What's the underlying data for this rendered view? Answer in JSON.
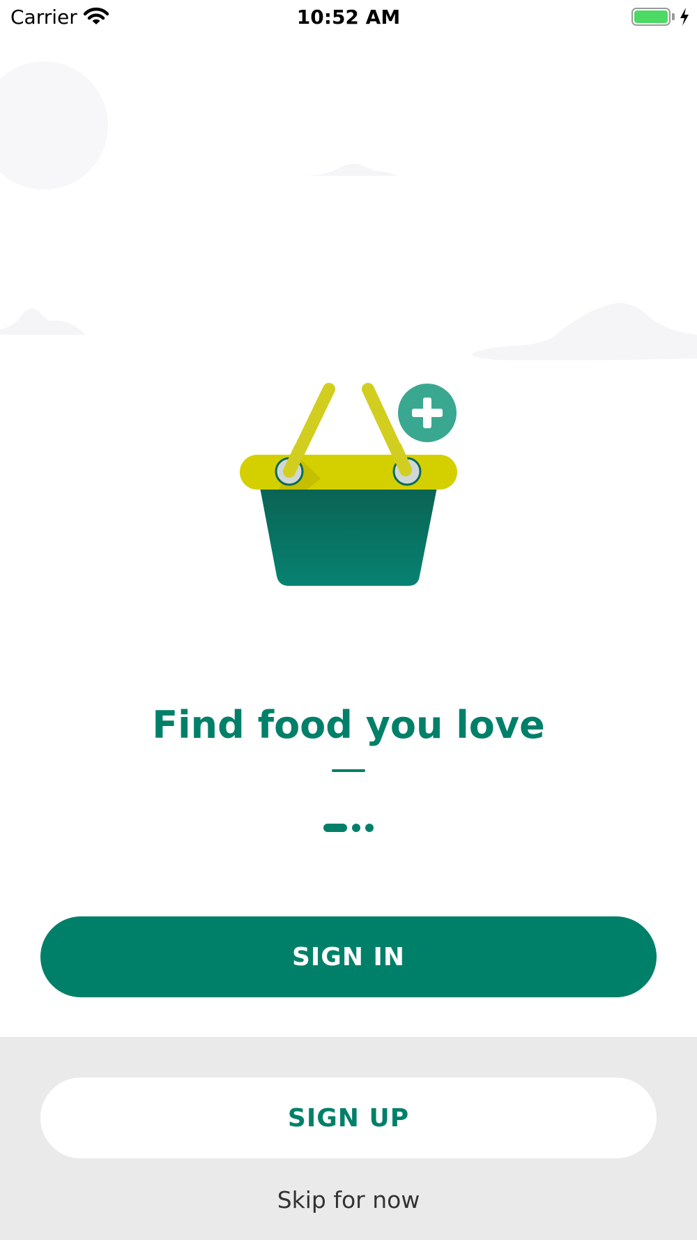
{
  "status_bar": {
    "carrier": "Carrier",
    "time": "10:52 AM",
    "battery_level": 1.0
  },
  "onboarding": {
    "title": "Find food you love",
    "page_count": 3,
    "current_page": 1
  },
  "actions": {
    "sign_in_label": "SIGN IN",
    "sign_up_label": "SIGN UP",
    "skip_label": "Skip for now"
  },
  "colors": {
    "primary": "#008069",
    "basket_rim": "#d4d000",
    "basket_body": "#086b5a",
    "plus_badge": "#3aa890",
    "bottom_panel": "#eaeaea"
  },
  "icons": [
    "wifi-icon",
    "battery-icon",
    "charging-bolt-icon",
    "basket-illustration",
    "plus-icon"
  ]
}
